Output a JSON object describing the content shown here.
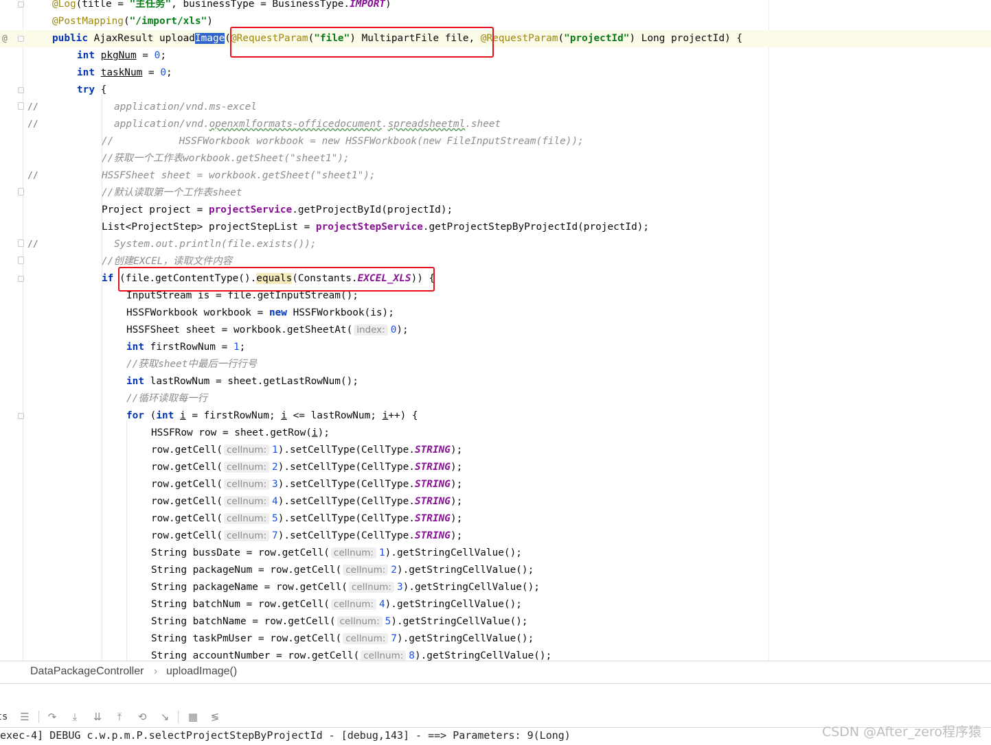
{
  "editor": {
    "lines": [
      {
        "gutter": "",
        "fold": "fold",
        "indent": 76,
        "tokens": [
          {
            "c": "ann",
            "t": "@Log"
          },
          {
            "t": "(title = "
          },
          {
            "c": "str",
            "t": "\"主任务\""
          },
          {
            "t": ", businessType = BusinessType."
          },
          {
            "c": "cst",
            "t": "IMPORT"
          },
          {
            "t": ")"
          }
        ]
      },
      {
        "gutter": "",
        "indent": 76,
        "tokens": [
          {
            "c": "ann",
            "t": "@PostMapping"
          },
          {
            "t": "("
          },
          {
            "c": "str",
            "t": "\"/import/xls\""
          },
          {
            "t": ")"
          }
        ]
      },
      {
        "gutter": "@",
        "fold": "fold",
        "indent": 76,
        "current": true,
        "tokens": [
          {
            "c": "kw",
            "t": "public "
          },
          {
            "t": "AjaxResult "
          },
          {
            "t": "upload"
          },
          {
            "c": "sel",
            "t": "Image"
          },
          {
            "t": "("
          },
          {
            "c": "ann",
            "t": "@RequestParam"
          },
          {
            "t": "("
          },
          {
            "c": "str",
            "t": "\"file\""
          },
          {
            "t": ") MultipartFile file, "
          },
          {
            "c": "ann",
            "t": "@RequestParam"
          },
          {
            "t": "("
          },
          {
            "c": "str",
            "t": "\"projectId\""
          },
          {
            "t": ") Long projectId) {"
          }
        ]
      },
      {
        "gutter": "",
        "indent": 112,
        "tokens": [
          {
            "c": "kw",
            "t": "int "
          },
          {
            "c": "und",
            "t": "pkgNum"
          },
          {
            "t": " = "
          },
          {
            "c": "num",
            "t": "0"
          },
          {
            "t": ";"
          }
        ]
      },
      {
        "gutter": "",
        "indent": 112,
        "tokens": [
          {
            "c": "kw",
            "t": "int "
          },
          {
            "c": "und",
            "t": "taskNum"
          },
          {
            "t": " = "
          },
          {
            "c": "num",
            "t": "0"
          },
          {
            "t": ";"
          }
        ]
      },
      {
        "gutter": "",
        "fold": "fold",
        "indent": 112,
        "tokens": [
          {
            "c": "kw",
            "t": "try "
          },
          {
            "t": "{"
          }
        ]
      },
      {
        "gutter": "//",
        "fold": "fold-cmt",
        "indent": 166,
        "tokens": [
          {
            "c": "cmt",
            "t": "application/vnd.ms-excel"
          }
        ]
      },
      {
        "gutter": "//",
        "indent": 166,
        "tokens": [
          {
            "c": "cmt",
            "t": "application/vnd."
          },
          {
            "c": "cmt wavy",
            "t": "openxmlformats-officedocument"
          },
          {
            "c": "cmt",
            "t": "."
          },
          {
            "c": "cmt wavy",
            "t": "spreadsheetml"
          },
          {
            "c": "cmt",
            "t": ".sheet"
          }
        ]
      },
      {
        "gutter": "",
        "indent": 148,
        "tokens": [
          {
            "c": "cmt",
            "t": "//           HSSFWorkbook workbook = new HSSFWorkbook(new FileInputStream(file));"
          }
        ]
      },
      {
        "gutter": "",
        "indent": 148,
        "tokens": [
          {
            "c": "cmt",
            "t": "//获取一个工作表workbook.getSheet(\"sheet1\");"
          }
        ]
      },
      {
        "gutter": "//",
        "indent": 148,
        "tokens": [
          {
            "c": "cmt",
            "t": "HSSFSheet sheet = workbook.getSheet(\"sheet1\");"
          }
        ]
      },
      {
        "gutter": "",
        "fold": "fold-cmt",
        "indent": 148,
        "tokens": [
          {
            "c": "cmt",
            "t": "//默认读取第一个工作表sheet"
          }
        ]
      },
      {
        "gutter": "",
        "indent": 148,
        "tokens": [
          {
            "t": "Project project = "
          },
          {
            "c": "fld",
            "t": "projectService"
          },
          {
            "t": ".getProjectById(projectId);"
          }
        ]
      },
      {
        "gutter": "",
        "indent": 148,
        "tokens": [
          {
            "t": "List<ProjectStep> projectStepList = "
          },
          {
            "c": "fld",
            "t": "projectStepService"
          },
          {
            "t": ".getProjectStepByProjectId(projectId);"
          }
        ]
      },
      {
        "gutter": "//",
        "fold": "fold-cmt",
        "indent": 166,
        "tokens": [
          {
            "c": "cmt",
            "t": "System.out.println(file.exists());"
          }
        ]
      },
      {
        "gutter": "",
        "fold": "fold-cmt",
        "indent": 148,
        "tokens": [
          {
            "c": "cmt",
            "t": "//创建EXCEL，读取文件内容"
          }
        ]
      },
      {
        "gutter": "",
        "fold": "fold",
        "indent": 148,
        "tokens": [
          {
            "c": "kw",
            "t": "if "
          },
          {
            "t": "(file.getContentType()."
          },
          {
            "c": "hl",
            "t": "equals"
          },
          {
            "t": "(Constants."
          },
          {
            "c": "cst",
            "t": "EXCEL_XLS"
          },
          {
            "t": ")) {"
          }
        ]
      },
      {
        "gutter": "",
        "indent": 184,
        "tokens": [
          {
            "t": "InputStream is = file.getInputStream();"
          }
        ]
      },
      {
        "gutter": "",
        "indent": 184,
        "tokens": [
          {
            "t": "HSSFWorkbook workbook = "
          },
          {
            "c": "kw",
            "t": "new "
          },
          {
            "t": "HSSFWorkbook(is);"
          }
        ]
      },
      {
        "gutter": "",
        "indent": 184,
        "tokens": [
          {
            "t": "HSSFSheet sheet = workbook.getSheetAt("
          },
          {
            "c": "hint",
            "t": "index:"
          },
          {
            "c": "num",
            "t": "0"
          },
          {
            "t": ");"
          }
        ]
      },
      {
        "gutter": "",
        "indent": 184,
        "tokens": [
          {
            "c": "kw",
            "t": "int "
          },
          {
            "t": "firstRowNum = "
          },
          {
            "c": "num",
            "t": "1"
          },
          {
            "t": ";"
          }
        ]
      },
      {
        "gutter": "",
        "indent": 184,
        "tokens": [
          {
            "c": "cmt",
            "t": "//获取sheet中最后一行行号"
          }
        ]
      },
      {
        "gutter": "",
        "indent": 184,
        "tokens": [
          {
            "c": "kw",
            "t": "int "
          },
          {
            "t": "lastRowNum = sheet.getLastRowNum();"
          }
        ]
      },
      {
        "gutter": "",
        "indent": 184,
        "tokens": [
          {
            "c": "cmt",
            "t": "//循环读取每一行"
          }
        ]
      },
      {
        "gutter": "",
        "fold": "fold",
        "indent": 184,
        "tokens": [
          {
            "c": "kw",
            "t": "for "
          },
          {
            "t": "("
          },
          {
            "c": "kw",
            "t": "int "
          },
          {
            "c": "und",
            "t": "i"
          },
          {
            "t": " = firstRowNum; "
          },
          {
            "c": "und",
            "t": "i"
          },
          {
            "t": " <= lastRowNum; "
          },
          {
            "c": "und",
            "t": "i"
          },
          {
            "t": "++) {"
          }
        ]
      },
      {
        "gutter": "",
        "indent": 220,
        "tokens": [
          {
            "t": "HSSFRow row = sheet.getRow("
          },
          {
            "c": "und",
            "t": "i"
          },
          {
            "t": ");"
          }
        ]
      },
      {
        "gutter": "",
        "indent": 220,
        "tokens": [
          {
            "t": "row.getCell("
          },
          {
            "c": "hint",
            "t": "cellnum:"
          },
          {
            "c": "num",
            "t": "1"
          },
          {
            "t": ").setCellType(CellType."
          },
          {
            "c": "cst",
            "t": "STRING"
          },
          {
            "t": ");"
          }
        ]
      },
      {
        "gutter": "",
        "indent": 220,
        "tokens": [
          {
            "t": "row.getCell("
          },
          {
            "c": "hint",
            "t": "cellnum:"
          },
          {
            "c": "num",
            "t": "2"
          },
          {
            "t": ").setCellType(CellType."
          },
          {
            "c": "cst",
            "t": "STRING"
          },
          {
            "t": ");"
          }
        ]
      },
      {
        "gutter": "",
        "indent": 220,
        "tokens": [
          {
            "t": "row.getCell("
          },
          {
            "c": "hint",
            "t": "cellnum:"
          },
          {
            "c": "num",
            "t": "3"
          },
          {
            "t": ").setCellType(CellType."
          },
          {
            "c": "cst",
            "t": "STRING"
          },
          {
            "t": ");"
          }
        ]
      },
      {
        "gutter": "",
        "indent": 220,
        "tokens": [
          {
            "t": "row.getCell("
          },
          {
            "c": "hint",
            "t": "cellnum:"
          },
          {
            "c": "num",
            "t": "4"
          },
          {
            "t": ").setCellType(CellType."
          },
          {
            "c": "cst",
            "t": "STRING"
          },
          {
            "t": ");"
          }
        ]
      },
      {
        "gutter": "",
        "indent": 220,
        "tokens": [
          {
            "t": "row.getCell("
          },
          {
            "c": "hint",
            "t": "cellnum:"
          },
          {
            "c": "num",
            "t": "5"
          },
          {
            "t": ").setCellType(CellType."
          },
          {
            "c": "cst",
            "t": "STRING"
          },
          {
            "t": ");"
          }
        ]
      },
      {
        "gutter": "",
        "indent": 220,
        "tokens": [
          {
            "t": "row.getCell("
          },
          {
            "c": "hint",
            "t": "cellnum:"
          },
          {
            "c": "num",
            "t": "7"
          },
          {
            "t": ").setCellType(CellType."
          },
          {
            "c": "cst",
            "t": "STRING"
          },
          {
            "t": ");"
          }
        ]
      },
      {
        "gutter": "",
        "indent": 220,
        "tokens": [
          {
            "t": "String bussDate = row.getCell("
          },
          {
            "c": "hint",
            "t": "cellnum:"
          },
          {
            "c": "num",
            "t": "1"
          },
          {
            "t": ").getStringCellValue();"
          }
        ]
      },
      {
        "gutter": "",
        "indent": 220,
        "tokens": [
          {
            "t": "String packageNum = row.getCell("
          },
          {
            "c": "hint",
            "t": "cellnum:"
          },
          {
            "c": "num",
            "t": "2"
          },
          {
            "t": ").getStringCellValue();"
          }
        ]
      },
      {
        "gutter": "",
        "indent": 220,
        "tokens": [
          {
            "t": "String packageName = row.getCell("
          },
          {
            "c": "hint",
            "t": "cellnum:"
          },
          {
            "c": "num",
            "t": "3"
          },
          {
            "t": ").getStringCellValue();"
          }
        ]
      },
      {
        "gutter": "",
        "indent": 220,
        "tokens": [
          {
            "t": "String batchNum = row.getCell("
          },
          {
            "c": "hint",
            "t": "cellnum:"
          },
          {
            "c": "num",
            "t": "4"
          },
          {
            "t": ").getStringCellValue();"
          }
        ]
      },
      {
        "gutter": "",
        "indent": 220,
        "tokens": [
          {
            "t": "String batchName = row.getCell("
          },
          {
            "c": "hint",
            "t": "cellnum:"
          },
          {
            "c": "num",
            "t": "5"
          },
          {
            "t": ").getStringCellValue();"
          }
        ]
      },
      {
        "gutter": "",
        "indent": 220,
        "tokens": [
          {
            "t": "String taskPmUser = row.getCell("
          },
          {
            "c": "hint",
            "t": "cellnum:"
          },
          {
            "c": "num",
            "t": "7"
          },
          {
            "t": ").getStringCellValue();"
          }
        ]
      },
      {
        "gutter": "",
        "indent": 220,
        "tokens": [
          {
            "t": "String accountNumber = row.getCell("
          },
          {
            "c": "hint",
            "t": "cellnum:"
          },
          {
            "c": "num",
            "t": "8"
          },
          {
            "t": ").getStringCellValue();"
          }
        ]
      }
    ]
  },
  "breadcrumb": {
    "items": [
      "DataPackageController",
      "uploadImage()"
    ],
    "separator": "›"
  },
  "toolbar": {
    "left_label": "ts",
    "icons": [
      "menu-lines-icon",
      "step-over-icon",
      "step-into-icon",
      "force-step-into-icon",
      "step-out-icon",
      "drop-frame-icon",
      "run-to-cursor-icon",
      "evaluate-expression-icon",
      "trace-settings-icon"
    ]
  },
  "console": {
    "text": "exec-4] DEBUG c.w.p.m.P.selectProjectStepByProjectId - [debug,143] - ==> Parameters: 9(Long)"
  },
  "watermark": {
    "text": "CSDN @After_zero程序猿"
  },
  "colors": {
    "annotation_box": "#e8101a",
    "keyword": "#0033b3",
    "string": "#067d17",
    "comment": "#8c8c8c",
    "selection": "#2f65ca",
    "current_line": "#fcfae8"
  }
}
